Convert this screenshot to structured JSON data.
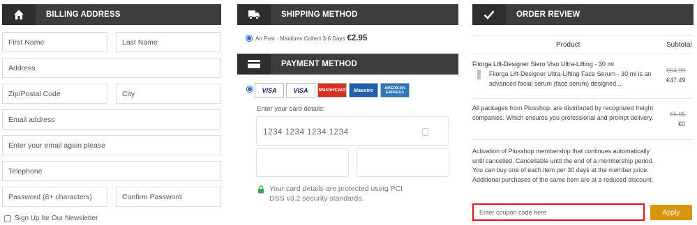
{
  "billing": {
    "title": "BILLING ADDRESS",
    "icon": "home-icon",
    "fields": {
      "first_name": "First Name",
      "last_name": "Last Name",
      "address": "Address",
      "zip": "Zip/Postal Code",
      "city": "City",
      "email": "Email address",
      "email_again": "Enter your email again please",
      "telephone": "Telephone",
      "password": "Password (8+ characters)",
      "confirm_password": "Confirm Password"
    },
    "newsletter": "Sign Up for Our Newsletter"
  },
  "shipping": {
    "title": "SHIPPING METHOD",
    "icon": "truck-icon",
    "option_text": "An Post - Maxibrev Collect 3-6 Days",
    "option_price": "€2.95"
  },
  "payment": {
    "title": "PAYMENT METHOD",
    "icon": "credit-card-icon",
    "cards": [
      "VISA",
      "VISA",
      "MasterCard",
      "Maestro",
      "AMERICAN EXPRESS"
    ],
    "card_label": "Enter your card details:",
    "card_number_placeholder": "1234 1234 1234 1234",
    "secure_text": "Your card details are protected using PCI DSS v3.2 security standards."
  },
  "review": {
    "title": "ORDER REVIEW",
    "icon": "checkmark-icon",
    "col_product": "Product",
    "col_subtotal": "Subtotal",
    "item_title": "Filorga Lift-Designer Siero Viso Ultra-Lifting - 30 ml",
    "item_desc": "Filorga Lift-Designer Ultra-Lifting Face Serum - 30 ml is an advanced facial serum (face serum) designed...",
    "item_old_price": "€64.99",
    "item_price": "€47.49",
    "shipping_note": "All packages from Plusshop. are distributed by recognized freight companies. Which ensures you professional and prompt delivery.",
    "shipping_old_price": "€5.95",
    "shipping_price": "€0",
    "membership_note": "Activation of Plusshop membership that continues automatically until cancelled. Cancellable until the end of a membership period. You can buy one of each item per 30 days at the member price. Additional purchases of the same item are at a reduced discount.",
    "coupon_placeholder": "Enter coupon code here",
    "apply_label": "Apply"
  },
  "colors": {
    "header_bg": "#3d3d3d",
    "accent_apply": "#d9950b",
    "coupon_border": "#e0141e",
    "radio": "#2a6fd6"
  }
}
